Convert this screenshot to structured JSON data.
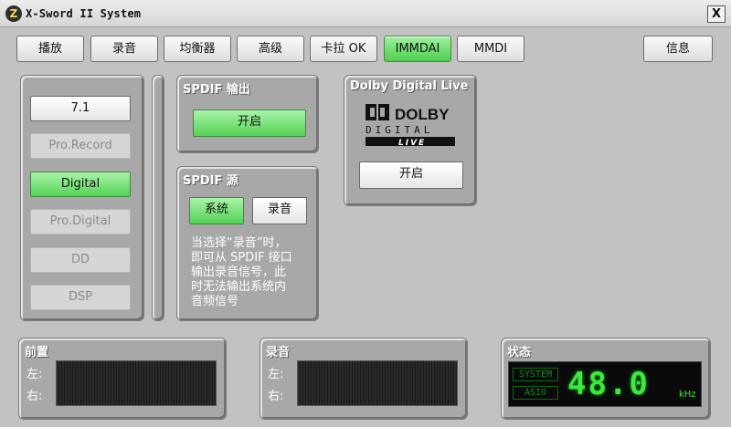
{
  "window": {
    "title": "X-Sword II System",
    "close_label": "X",
    "app_icon_glyph": "Z"
  },
  "tabs": [
    {
      "label": "播放",
      "active": false
    },
    {
      "label": "录音",
      "active": false
    },
    {
      "label": "均衡器",
      "active": false
    },
    {
      "label": "高级",
      "active": false
    },
    {
      "label": "卡拉 OK",
      "active": false
    },
    {
      "label": "IMMDAI",
      "active": true
    },
    {
      "label": "MMDI",
      "active": false
    }
  ],
  "info_button": "信息",
  "modes": [
    {
      "label": "7.1",
      "state": "normal"
    },
    {
      "label": "Pro.Record",
      "state": "disabled"
    },
    {
      "label": "Digital",
      "state": "active"
    },
    {
      "label": "Pro.Digital",
      "state": "disabled"
    },
    {
      "label": "DD",
      "state": "disabled"
    },
    {
      "label": "DSP",
      "state": "disabled"
    }
  ],
  "spdif_out": {
    "title": "SPDIF 输出",
    "button": "开启"
  },
  "spdif_src": {
    "title": "SPDIF 源",
    "system_button": "系统",
    "record_button": "录音",
    "note": "当选择“录音”时，即可从 SPDIF 接口输出录音信号，此时无法输出系统内音频信号",
    "note_lines": [
      "当选择“录音”时，",
      "即可从 SPDIF 接口",
      "输出录音信号，此",
      "时无法输出系统内",
      "音频信号"
    ]
  },
  "dolby": {
    "title": "Dolby Digital Live",
    "button": "开启",
    "logo_word": "DOLBY",
    "logo_line1": "DIGITAL",
    "logo_line2": "LIVE"
  },
  "front": {
    "title": "前置",
    "left": "左:",
    "right": "右:"
  },
  "record": {
    "title": "录音",
    "left": "左:",
    "right": "右:"
  },
  "status": {
    "title": "状态",
    "tag1": "SYSTEM",
    "tag2": "ASIO",
    "value": "48.0",
    "unit": "kHz"
  },
  "colors": {
    "accent_green": "#55d255",
    "display_green": "#3bea3b",
    "panel_gray": "#a8a8a8"
  }
}
